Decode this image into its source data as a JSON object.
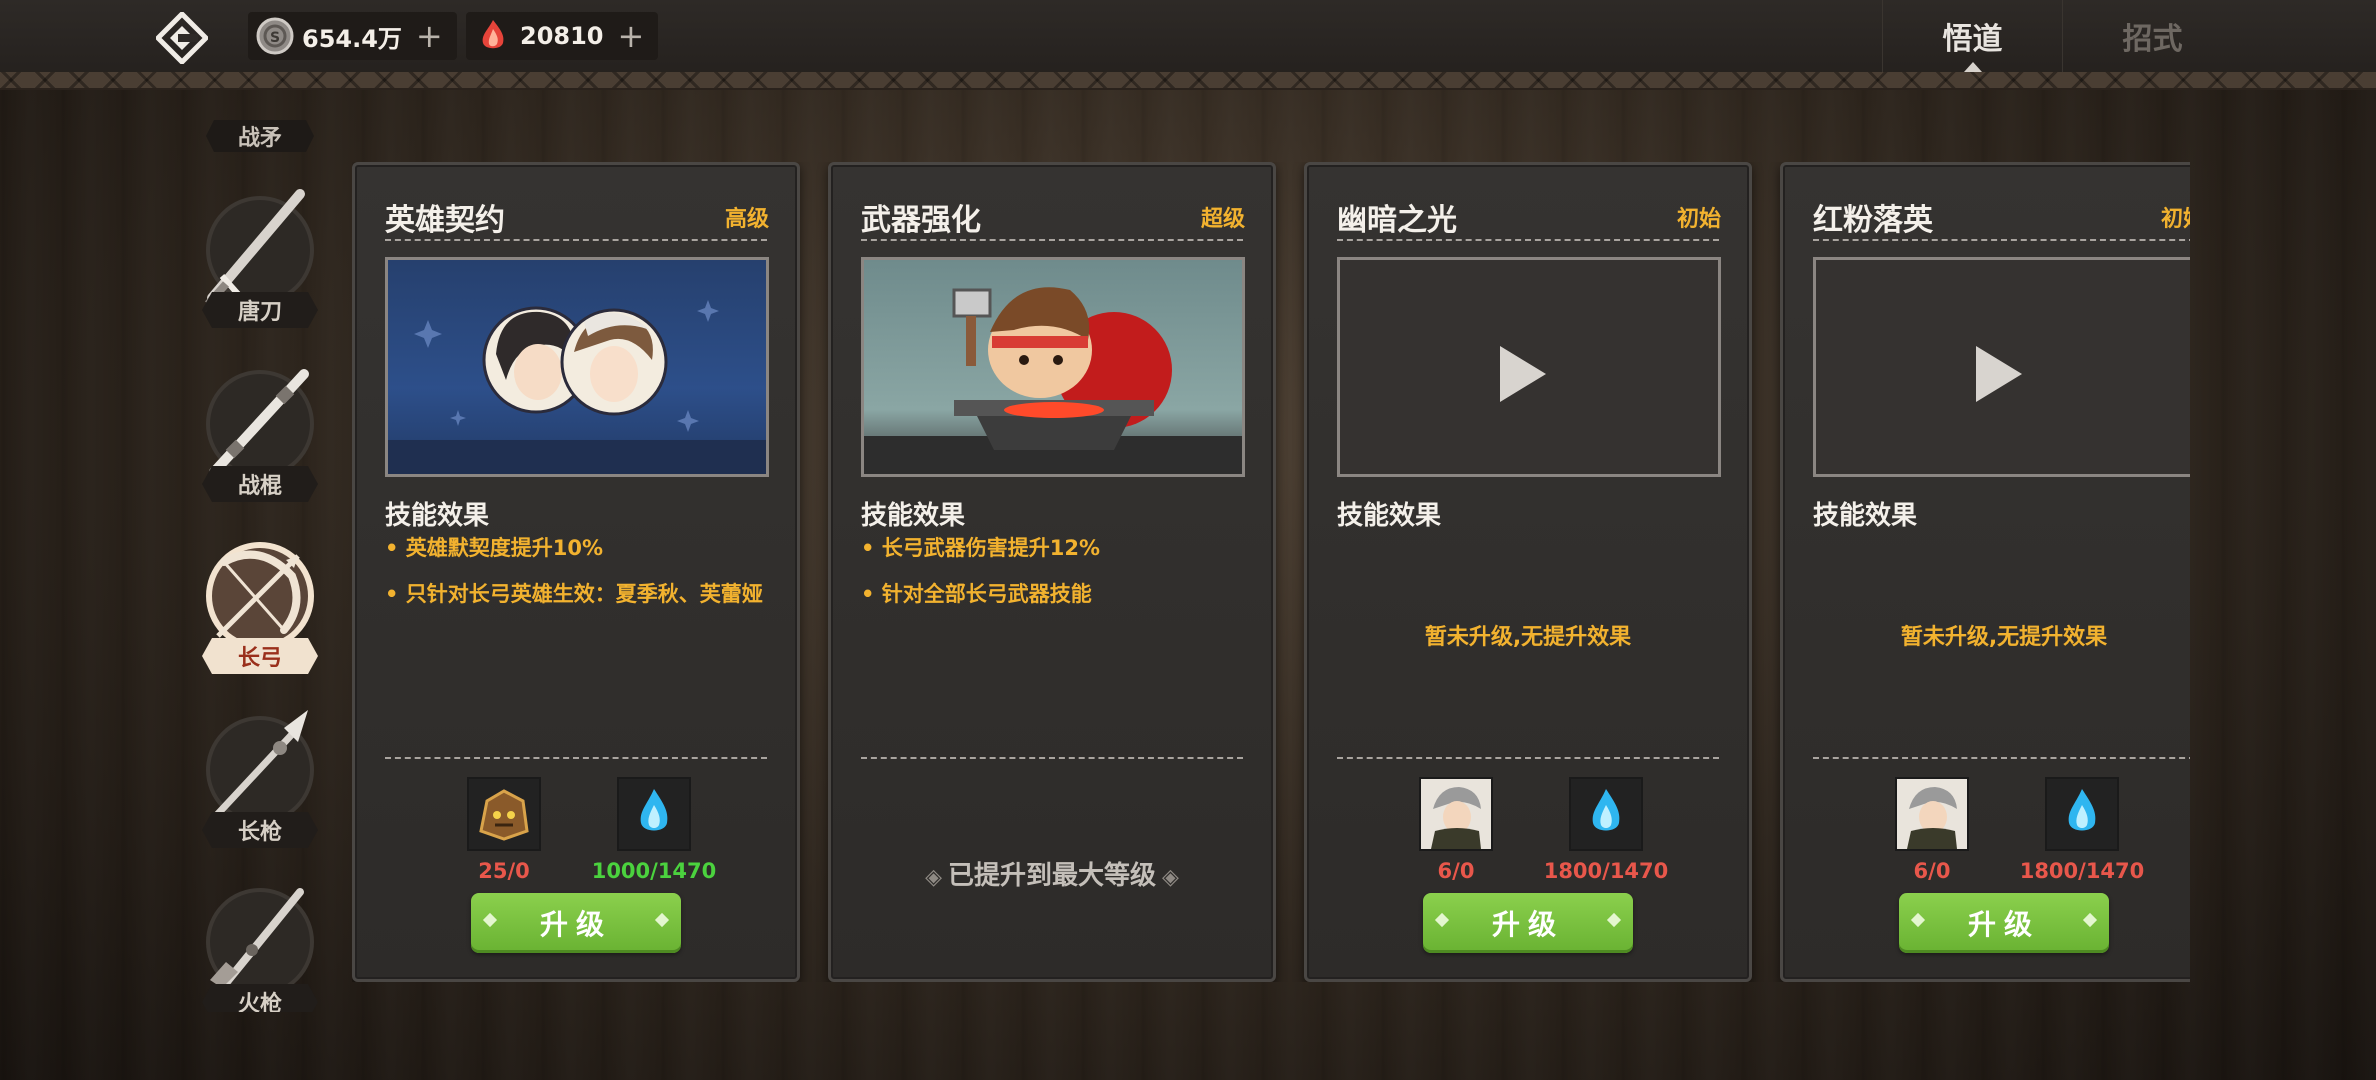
{
  "currencies": [
    {
      "icon": "silver-coin-icon",
      "value": "654.4万",
      "plus": "+"
    },
    {
      "icon": "red-crystal-icon",
      "value": "20810",
      "plus": "+"
    }
  ],
  "tabs": [
    {
      "label": "悟道",
      "active": true
    },
    {
      "label": "招式",
      "active": false
    }
  ],
  "sidebar": {
    "category_label": "战矛",
    "weapons": [
      {
        "label": "唐刀",
        "icon": "sword-icon",
        "active": false
      },
      {
        "label": "战棍",
        "icon": "staff-icon",
        "active": false
      },
      {
        "label": "长弓",
        "icon": "bow-icon",
        "active": true
      },
      {
        "label": "长枪",
        "icon": "spear-icon",
        "active": false
      },
      {
        "label": "火枪",
        "icon": "musket-icon",
        "active": false
      }
    ]
  },
  "cards": [
    {
      "title": "英雄契约",
      "grade": "高级",
      "media": "hero-portraits",
      "effect_title": "技能效果",
      "bullets": [
        "• 英雄默契度提升10%",
        "• 只针对长弓英雄生效：夏季秋、芙蕾娅"
      ],
      "materials": [
        {
          "icon": "rock-golem-icon",
          "count": "25/0",
          "color": "red"
        },
        {
          "icon": "blue-flame-icon",
          "count": "1000/1470",
          "color": "green"
        }
      ],
      "button": "升级"
    },
    {
      "title": "武器强化",
      "grade": "超级",
      "media": "blacksmith",
      "effect_title": "技能效果",
      "bullets": [
        "• 长弓武器伤害提升12%",
        "• 针对全部长弓武器技能"
      ],
      "maxed_text": "已提升到最大等级"
    },
    {
      "title": "幽暗之光",
      "grade": "初始",
      "media": "video-placeholder",
      "effect_title": "技能效果",
      "no_effect": "暂未升级,无提升效果",
      "materials": [
        {
          "icon": "hero-avatar-icon",
          "count": "6/0",
          "color": "red"
        },
        {
          "icon": "blue-flame-icon",
          "count": "1800/1470",
          "color": "red"
        }
      ],
      "button": "升级"
    },
    {
      "title": "红粉落英",
      "grade": "初始",
      "media": "video-placeholder",
      "effect_title": "技能效果",
      "no_effect": "暂未升级,无提升效果",
      "materials": [
        {
          "icon": "hero-avatar-icon",
          "count": "6/0",
          "color": "red"
        },
        {
          "icon": "blue-flame-icon",
          "count": "1800/1470",
          "color": "red"
        }
      ],
      "button": "升级"
    }
  ],
  "colors": {
    "grade": "#f2b22f",
    "button": "#74bb3a",
    "count_red": "#e8574b",
    "count_green": "#4bd23e",
    "active_weapon_label": "#9a2f1b"
  }
}
